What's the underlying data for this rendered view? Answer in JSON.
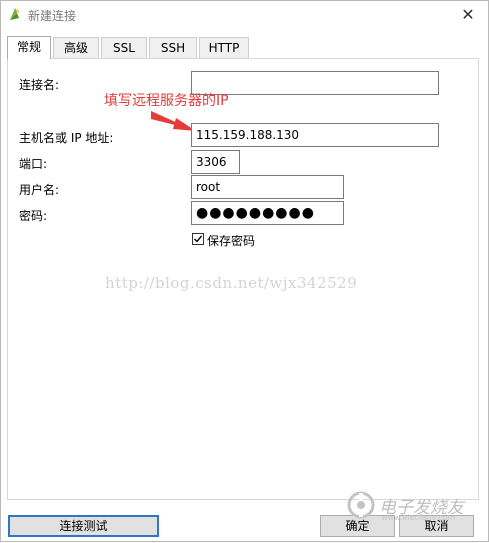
{
  "window": {
    "title": "新建连接",
    "close_glyph": "✕"
  },
  "tabs": [
    {
      "label": "常规",
      "active": true
    },
    {
      "label": "高级",
      "active": false
    },
    {
      "label": "SSL",
      "active": false
    },
    {
      "label": "SSH",
      "active": false
    },
    {
      "label": "HTTP",
      "active": false
    }
  ],
  "form": {
    "connection_name": {
      "label": "连接名:",
      "value": ""
    },
    "host": {
      "label": "主机名或 IP 地址:",
      "value": "115.159.188.130"
    },
    "port": {
      "label": "端口:",
      "value": "3306"
    },
    "username": {
      "label": "用户名:",
      "value": "root"
    },
    "password": {
      "label": "密码:",
      "value": "●●●●●●●●●"
    },
    "save_password": {
      "label": "保存密码",
      "checked": true
    }
  },
  "annotation": {
    "text": "填写远程服务器的IP",
    "color": "#e53b3b"
  },
  "watermark": {
    "text": "http://blog.csdn.net/wjx342529"
  },
  "buttons": {
    "test_connection": "连接测试",
    "ok": "确定",
    "cancel": "取消"
  },
  "logo_watermark": {
    "text": "电子发烧友",
    "url": "www.elecfans.com"
  },
  "colors": {
    "accent_border": "#2f76c4",
    "annotation_red": "#e53b3b"
  }
}
